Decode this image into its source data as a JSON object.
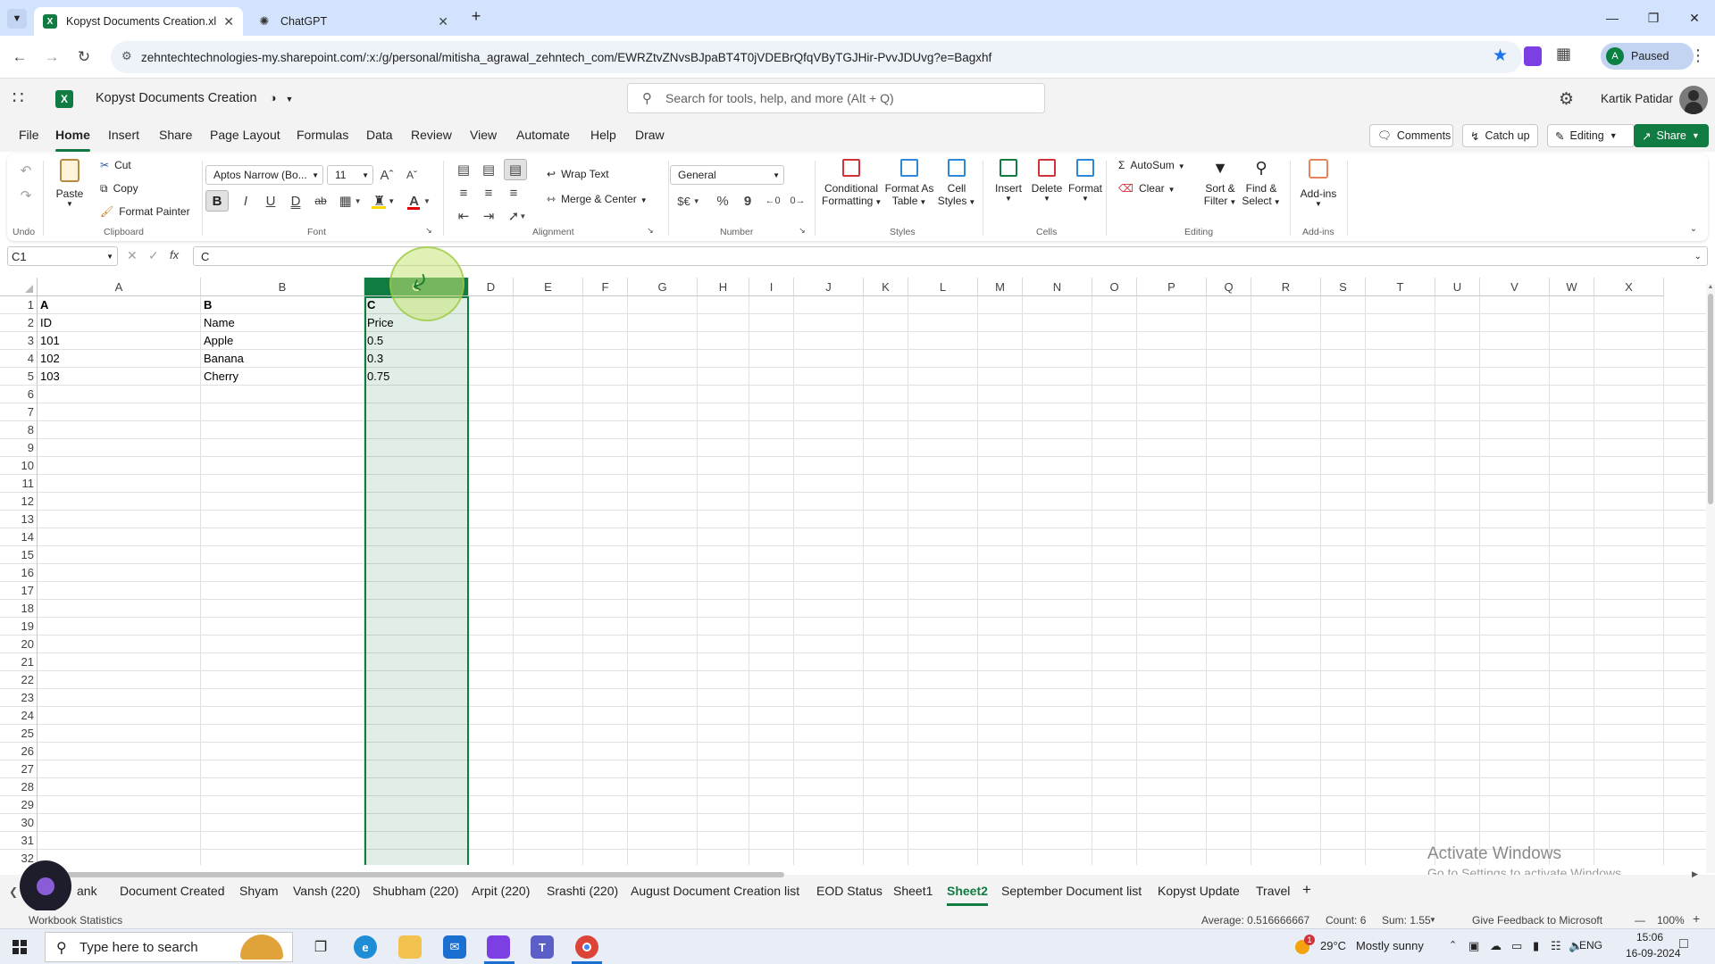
{
  "browser": {
    "tabs": [
      {
        "title": "Kopyst Documents Creation.xls",
        "icon": "excel-icon",
        "active": true
      },
      {
        "title": "ChatGPT",
        "icon": "chatgpt-icon",
        "active": false
      }
    ],
    "url": "zehntechtechnologies-my.sharepoint.com/:x:/g/personal/mitisha_agrawal_zehntech_com/EWRZtvZNvsBJpaBT4T0jVDEBrQfqVByTGJHir-PvvJDUvg?e=Bagxhf",
    "profile_initial": "A",
    "profile_status": "Paused"
  },
  "app": {
    "file_name": "Kopyst Documents Creation",
    "search_placeholder": "Search for tools, help, and more (Alt + Q)",
    "user_name": "Kartik Patidar",
    "brand_color": "#107c41"
  },
  "menu": {
    "items": [
      "File",
      "Home",
      "Insert",
      "Share",
      "Page Layout",
      "Formulas",
      "Data",
      "Review",
      "View",
      "Automate",
      "Help",
      "Draw"
    ],
    "active": "Home",
    "comments": "Comments",
    "catch_up": "Catch up",
    "editing": "Editing",
    "share": "Share"
  },
  "ribbon": {
    "undo_group": "Undo",
    "paste": "Paste",
    "cut": "Cut",
    "copy": "Copy",
    "format_painter": "Format Painter",
    "clipboard_group": "Clipboard",
    "font_name": "Aptos Narrow (Bo...",
    "font_size": "11",
    "bold": "B",
    "italic": "I",
    "underline": "U",
    "double_underline": "D",
    "strikethrough": "ab",
    "font_group": "Font",
    "wrap_text": "Wrap Text",
    "merge_center": "Merge & Center",
    "alignment_group": "Alignment",
    "number_format": "General",
    "currency": "$€",
    "percent": "%",
    "comma": "9",
    "number_group": "Number",
    "conditional_formatting_1": "Conditional",
    "conditional_formatting_2": "Formatting",
    "format_as_table_1": "Format As",
    "format_as_table_2": "Table",
    "cell_styles_1": "Cell",
    "cell_styles_2": "Styles",
    "styles_group": "Styles",
    "insert": "Insert",
    "delete": "Delete",
    "format": "Format",
    "cells_group": "Cells",
    "autosum": "AutoSum",
    "clear": "Clear",
    "sort_filter_1": "Sort &",
    "sort_filter_2": "Filter",
    "find_select_1": "Find &",
    "find_select_2": "Select",
    "editing_group": "Editing",
    "addins": "Add-ins",
    "addins_group": "Add-ins"
  },
  "formula_bar": {
    "name_box": "C1",
    "formula": "C"
  },
  "grid": {
    "columns": [
      "A",
      "B",
      "C",
      "D",
      "E",
      "F",
      "G",
      "H",
      "I",
      "J",
      "K",
      "L",
      "M",
      "N",
      "O",
      "P",
      "Q",
      "R",
      "S",
      "T",
      "U",
      "V",
      "W",
      "X"
    ],
    "selected_column": "C",
    "row_numbers": [
      "1",
      "2",
      "3",
      "4",
      "5",
      "6",
      "7",
      "8",
      "9",
      "10",
      "11",
      "12",
      "13",
      "14",
      "15",
      "16",
      "17",
      "18",
      "19",
      "20",
      "21",
      "22",
      "23",
      "24",
      "25",
      "26",
      "27",
      "28",
      "29",
      "30",
      "31",
      "32"
    ],
    "rows": [
      [
        "A",
        "B",
        "C"
      ],
      [
        "ID",
        "Name",
        "Price"
      ],
      [
        "101",
        "Apple",
        "0.5"
      ],
      [
        "102",
        "Banana",
        "0.3"
      ],
      [
        "103",
        "Cherry",
        "0.75"
      ]
    ]
  },
  "sheets": {
    "tabs": [
      "ank",
      "Document Created",
      "Shyam",
      "Vansh (220)",
      "Shubham (220)",
      "Arpit (220)",
      "Srashti (220)",
      "August Document Creation list",
      "EOD Status",
      "Sheet1",
      "Sheet2",
      "September Document list",
      "Kopyst Update",
      "Travel"
    ],
    "active": "Sheet2",
    "add": "+"
  },
  "status": {
    "workbook_statistics": "Workbook Statistics",
    "average": "Average: 0.516666667",
    "count": "Count: 6",
    "sum": "Sum: 1.55",
    "feedback": "Give Feedback to Microsoft",
    "zoom": "100%"
  },
  "watermark": {
    "line1": "Activate Windows",
    "line2": "Go to Settings to activate Windows."
  },
  "taskbar": {
    "search_placeholder": "Type here to search",
    "weather_temp": "29°C",
    "weather_desc": "Mostly sunny",
    "lang": "ENG",
    "time": "15:06",
    "date": "16-09-2024",
    "notification_badge": "1"
  }
}
